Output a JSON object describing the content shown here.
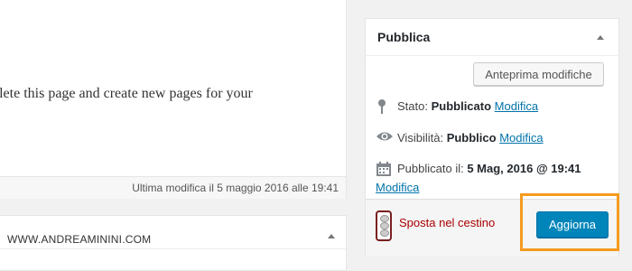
{
  "editor": {
    "body_text": "elete this page and create new pages for your",
    "last_modified": "Ultima modifica il 5 maggio 2016 alle 19:41"
  },
  "lower_box": {
    "title": "WWW.ANDREAMININI.COM"
  },
  "publish": {
    "title": "Pubblica",
    "preview_label": "Anteprima modifiche",
    "status_label": "Stato:",
    "status_value": "Pubblicato",
    "visibility_label": "Visibilità:",
    "visibility_value": "Pubblico",
    "published_label": "Pubblicato il:",
    "published_value": "5 Mag, 2016 @ 19:41",
    "edit_label": "Modifica",
    "trash_label": "Sposta nel cestino",
    "update_label": "Aggiorna"
  },
  "icons": {
    "status": "pin-icon",
    "visibility": "eye-icon",
    "calendar": "calendar-icon",
    "trash": "trash-icon",
    "toggle": "triangle-up-icon"
  },
  "colors": {
    "link": "#0073aa",
    "primary_button": "#0085ba",
    "trash": "#a00",
    "highlight": "#f59b1e"
  }
}
